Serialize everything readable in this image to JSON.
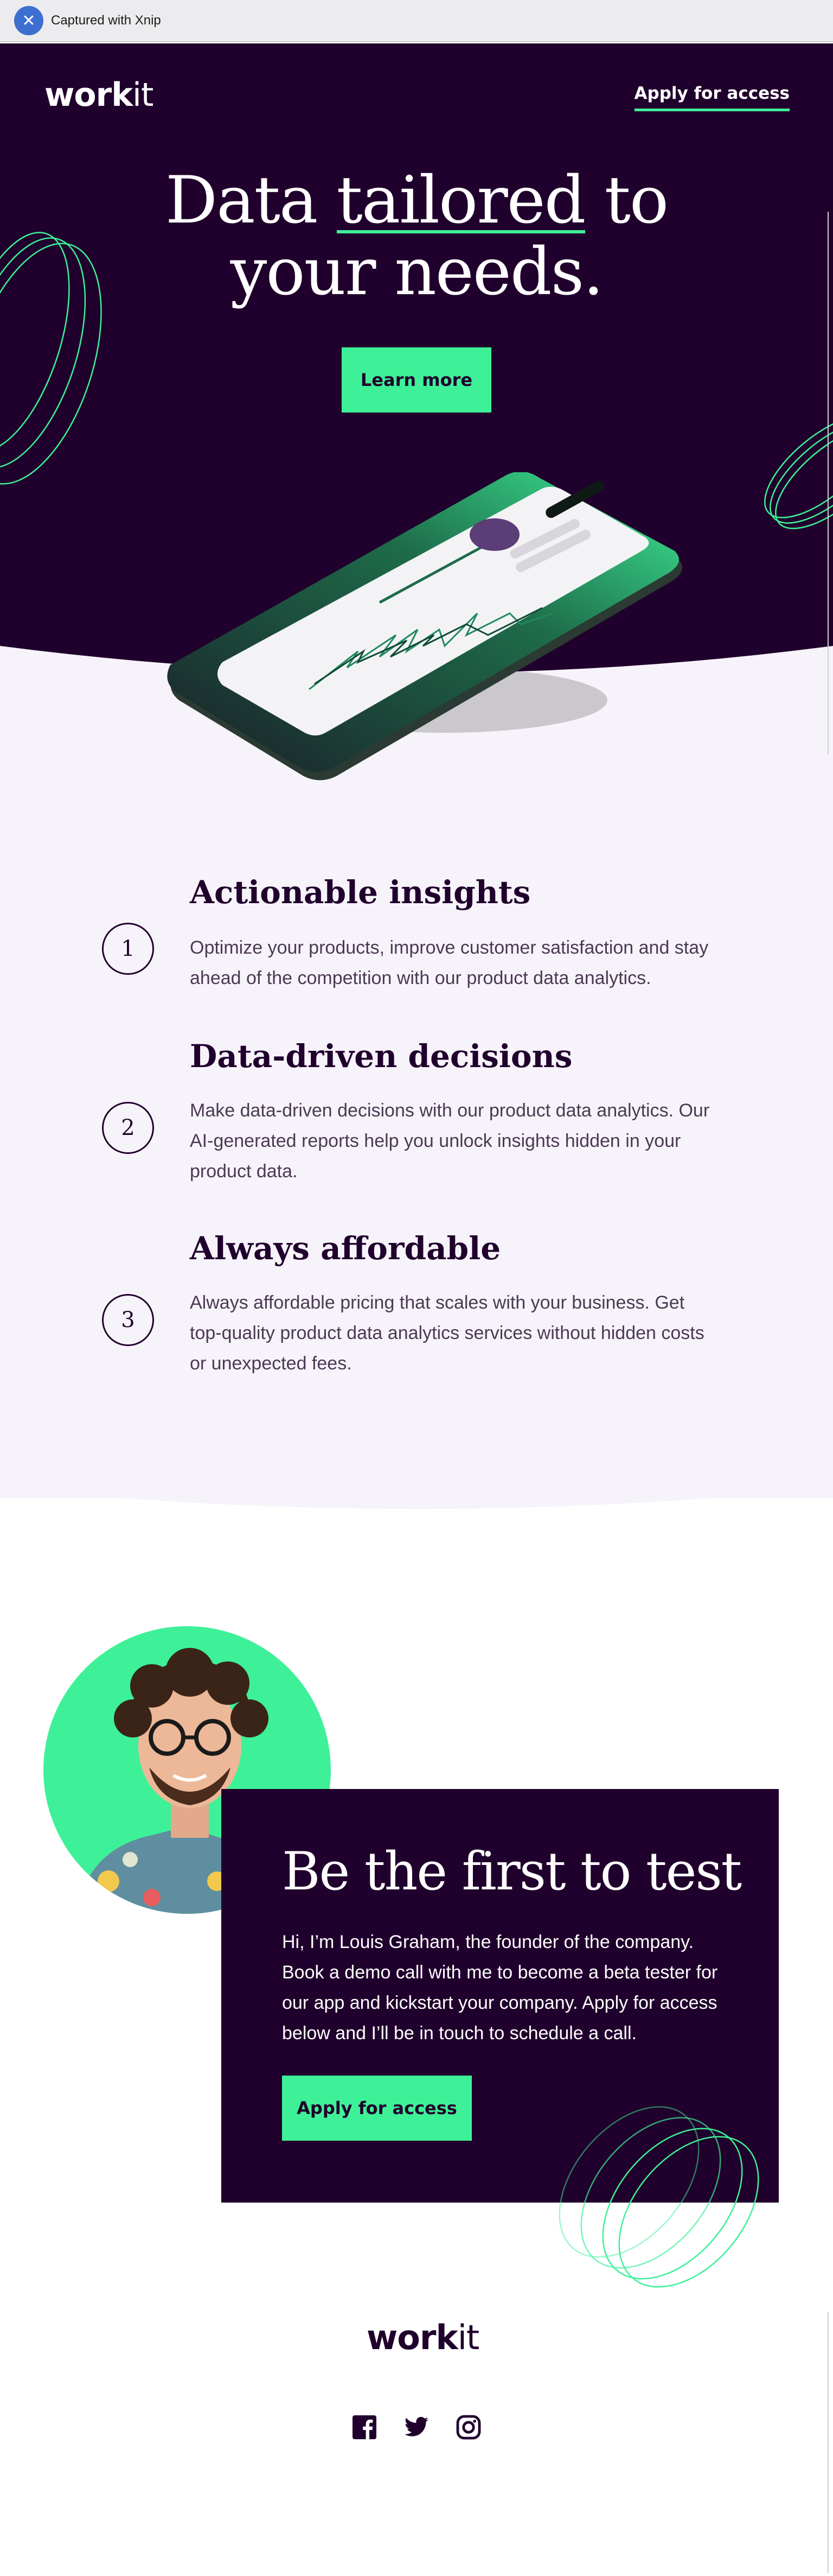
{
  "capture_bar": {
    "label": "Captured with Xnip",
    "icon": "xnip-logo-icon"
  },
  "brand": {
    "logo_bold": "work",
    "logo_light": "it",
    "accent": "#3ef198",
    "dark": "#20002c",
    "light_bg": "#f7f3fa"
  },
  "header": {
    "cta_label": "Apply for access"
  },
  "hero": {
    "title_part1": "Data ",
    "title_underlined": "tailored",
    "title_part2": " to",
    "title_line2": "your needs.",
    "button_label": "Learn more"
  },
  "features": [
    {
      "number": "1",
      "title": "Actionable insights",
      "body": "Optimize your products, improve customer satisfaction and stay ahead of the competition with our product data analytics."
    },
    {
      "number": "2",
      "title": "Data-driven decisions",
      "body": "Make data-driven decisions with our product data analytics. Our AI-generated reports help you unlock insights hidden in your product data."
    },
    {
      "number": "3",
      "title": "Always affordable",
      "body": "Always affordable pricing that scales with your business. Get top-quality product data analytics services without hidden costs or unexpected fees."
    }
  ],
  "cta": {
    "title": "Be the first to test",
    "body": "Hi, I’m Louis Graham, the founder of the company. Book a demo call with me to become a beta tester for our app and kickstart your company. Apply for access below and I’ll be in touch to schedule a call.",
    "button_label": "Apply for access"
  },
  "footer": {
    "logo_bold": "work",
    "logo_light": "it",
    "social": [
      "facebook-icon",
      "twitter-icon",
      "instagram-icon"
    ]
  }
}
